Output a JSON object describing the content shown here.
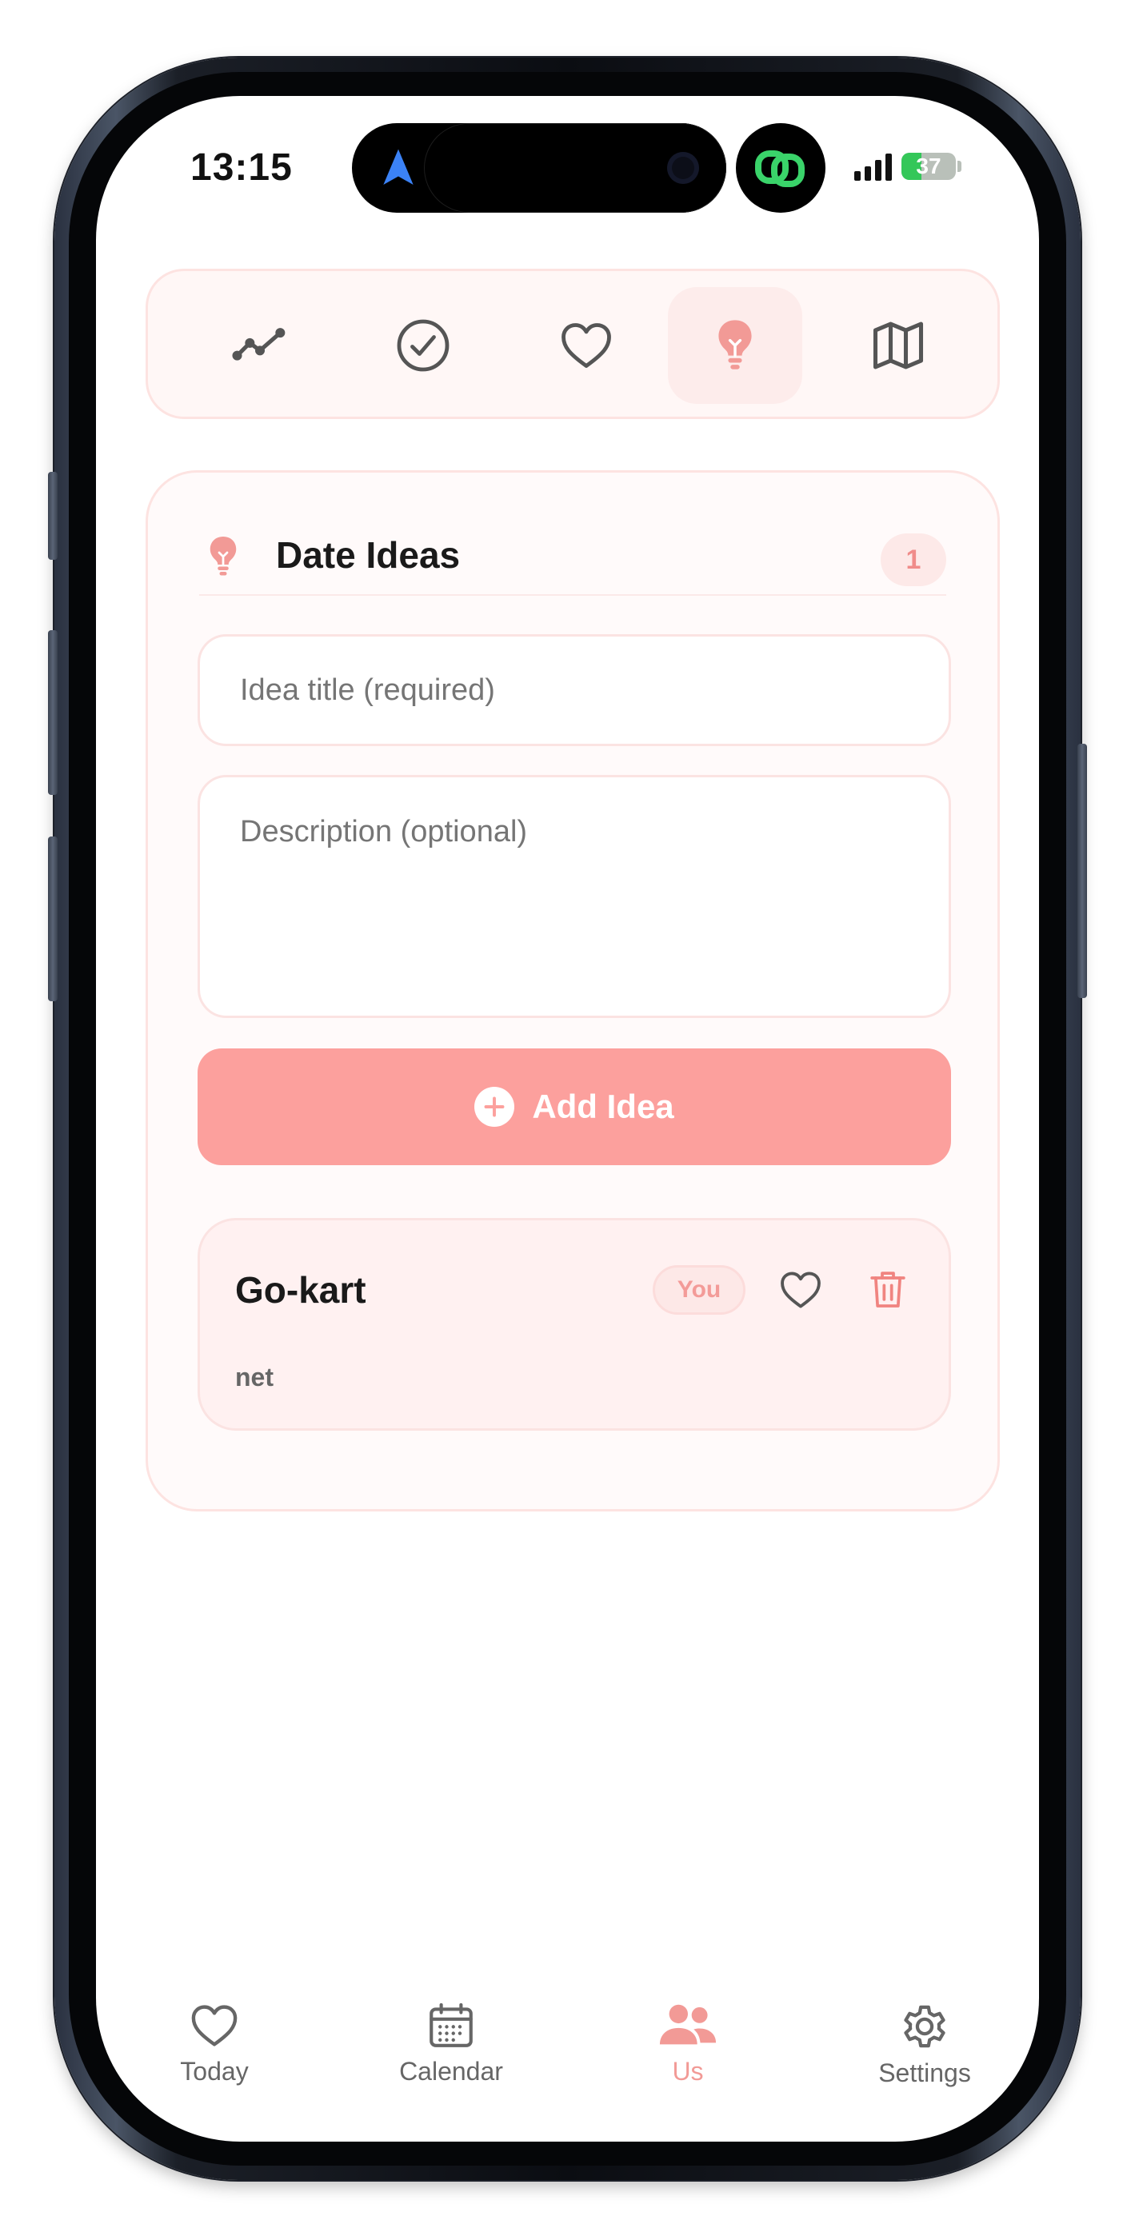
{
  "status_bar": {
    "time": "13:15",
    "battery": "37"
  },
  "top_tabs": [
    {
      "name": "stats-trend",
      "icon": "trend-line-icon",
      "active": false
    },
    {
      "name": "checklist",
      "icon": "check-circle-icon",
      "active": false
    },
    {
      "name": "favorites",
      "icon": "heart-icon",
      "active": false
    },
    {
      "name": "date-ideas",
      "icon": "lightbulb-icon",
      "active": true
    },
    {
      "name": "map",
      "icon": "map-icon",
      "active": false
    }
  ],
  "date_ideas": {
    "title": "Date Ideas",
    "count": "1",
    "title_placeholder": "Idea title (required)",
    "description_placeholder": "Description (optional)",
    "add_button_label": "Add Idea",
    "ideas": [
      {
        "title": "Go-kart",
        "description": "net",
        "author_badge": "You"
      }
    ]
  },
  "bottom_tabs": [
    {
      "label": "Today",
      "icon": "heart-icon",
      "active": false
    },
    {
      "label": "Calendar",
      "icon": "calendar-icon",
      "active": false
    },
    {
      "label": "Us",
      "icon": "people-icon",
      "active": true
    },
    {
      "label": "Settings",
      "icon": "gear-icon",
      "active": false
    }
  ],
  "colors": {
    "accent": "#f29a96",
    "button": "#fca09d",
    "card_bg": "#fffafa",
    "border": "#fde3e1"
  }
}
